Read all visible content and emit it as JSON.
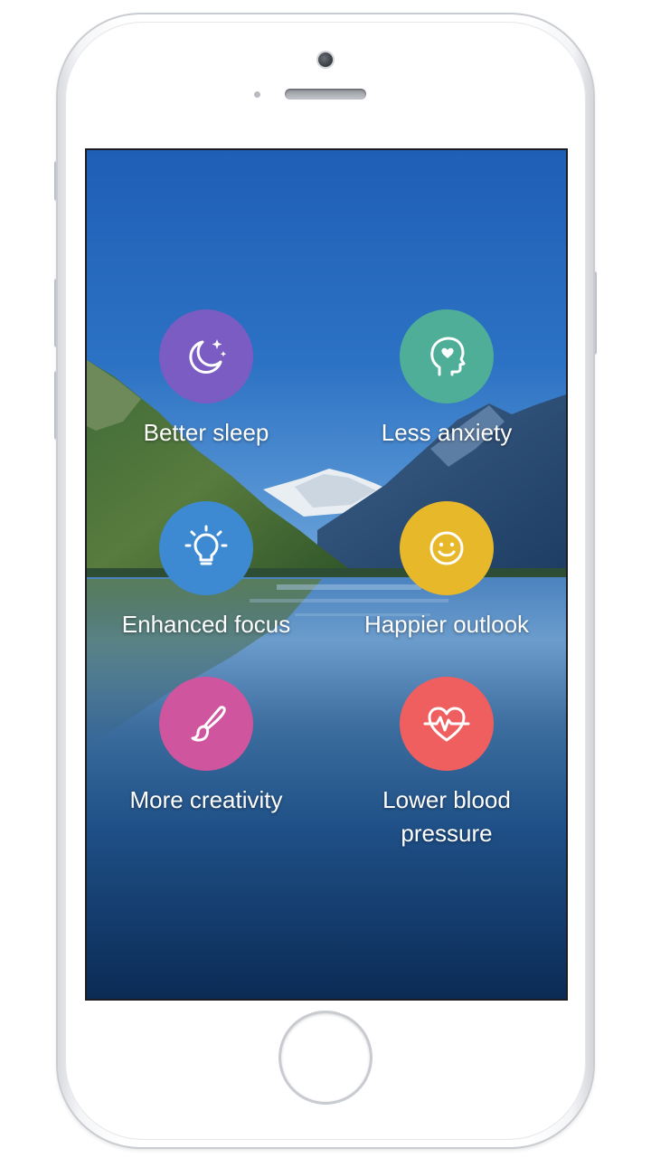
{
  "colors": {
    "sleep": "#7a5cc3",
    "anxiety": "#4fae97",
    "focus": "#3d8ad2",
    "outlook": "#e8b82b",
    "creativity": "#cf559f",
    "blood_pressure": "#f05f5f"
  },
  "benefits": [
    {
      "label": "Better sleep",
      "icon": "moon-stars-icon",
      "color": "#7a5cc3"
    },
    {
      "label": "Less anxiety",
      "icon": "head-heart-icon",
      "color": "#4fae97"
    },
    {
      "label": "Enhanced focus",
      "icon": "lightbulb-icon",
      "color": "#3d8ad2"
    },
    {
      "label": "Happier outlook",
      "icon": "smiley-icon",
      "color": "#e8b82b"
    },
    {
      "label": "More creativity",
      "icon": "paintbrush-icon",
      "color": "#cf559f"
    },
    {
      "label": "Lower blood pressure",
      "icon": "heart-pulse-icon",
      "color": "#f05f5f"
    }
  ]
}
